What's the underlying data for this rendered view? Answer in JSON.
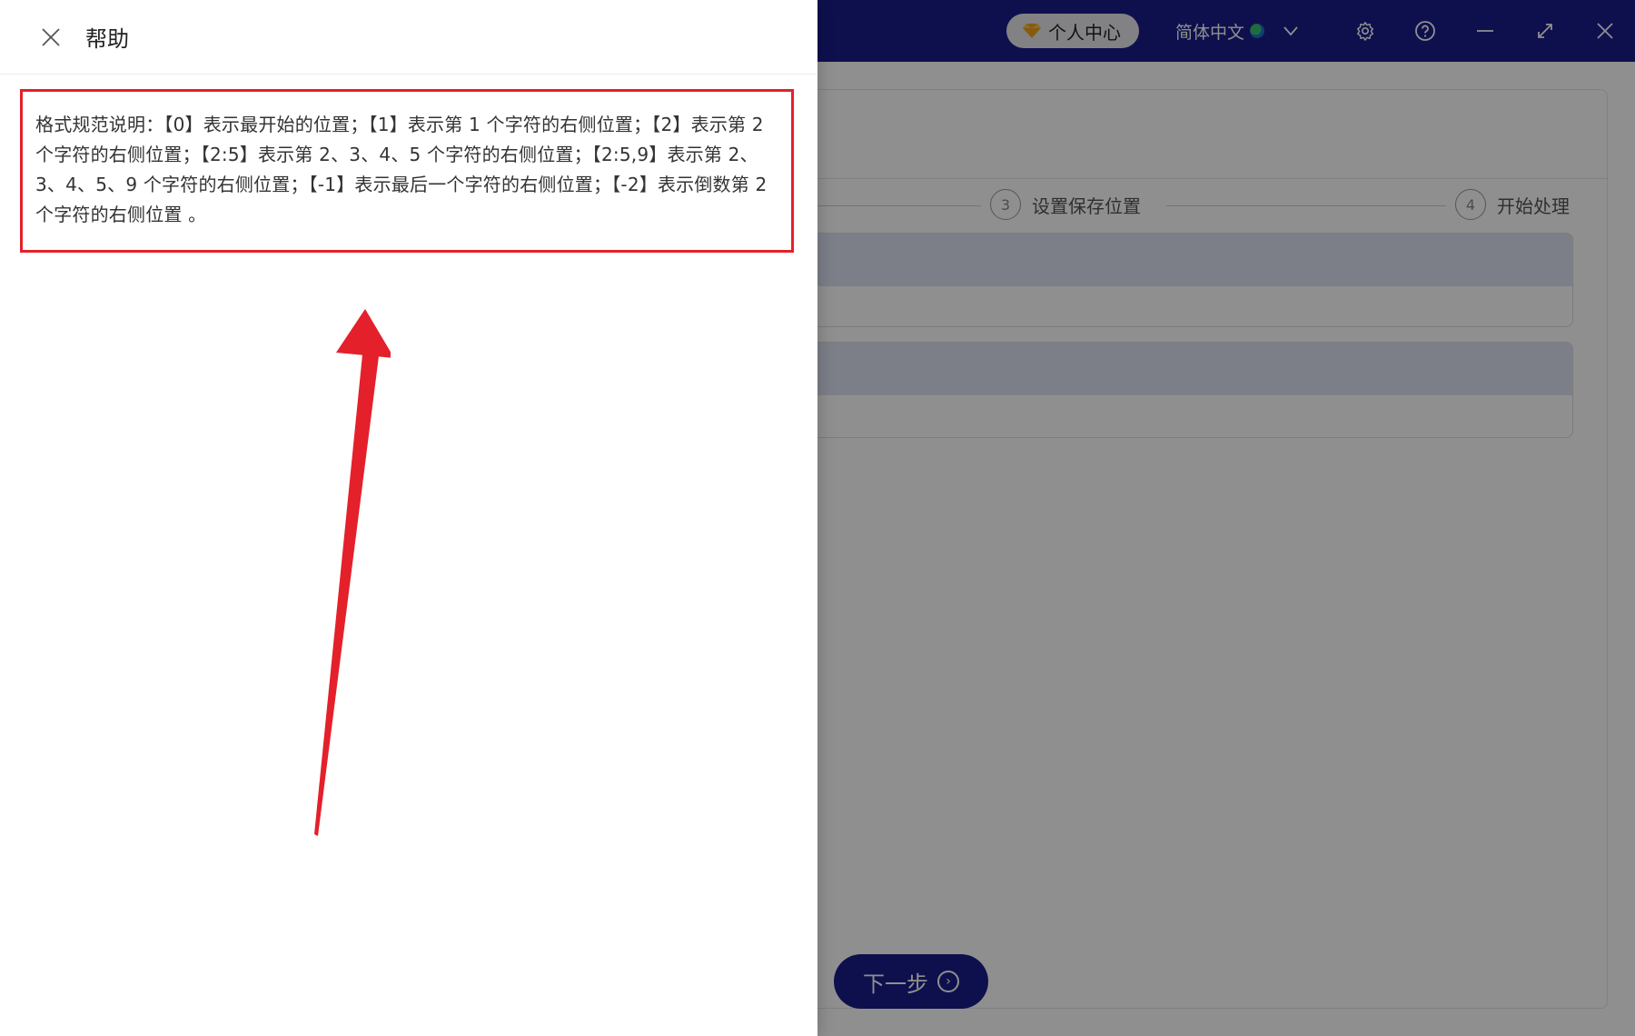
{
  "titlebar": {
    "vip_label": "个人中心",
    "language_label": "简体中文",
    "icons": [
      "diamond-icon",
      "globe-icon",
      "chevron-down-icon",
      "gear-icon",
      "help-icon",
      "minimize-icon",
      "expand-icon",
      "close-icon"
    ]
  },
  "steps": [
    {
      "number": "3",
      "label": "设置保存位置"
    },
    {
      "number": "4",
      "label": "开始处理"
    }
  ],
  "next_button": {
    "label": "下一步"
  },
  "drawer": {
    "title": "帮助",
    "help_text": "格式规范说明：【0】表示最开始的位置；【1】表示第 1 个字符的右侧位置；【2】表示第 2 个字符的右侧位置；【2:5】表示第 2、3、4、5 个字符的右侧位置；【2:5,9】表示第 2、3、4、5、9 个字符的右侧位置；【-1】表示最后一个字符的右侧位置；【-2】表示倒数第 2 个字符的右侧位置 。"
  },
  "colors": {
    "titlebar": "#1a1e8c",
    "highlight_border": "#e4202a",
    "annotation_arrow": "#e4202a"
  }
}
